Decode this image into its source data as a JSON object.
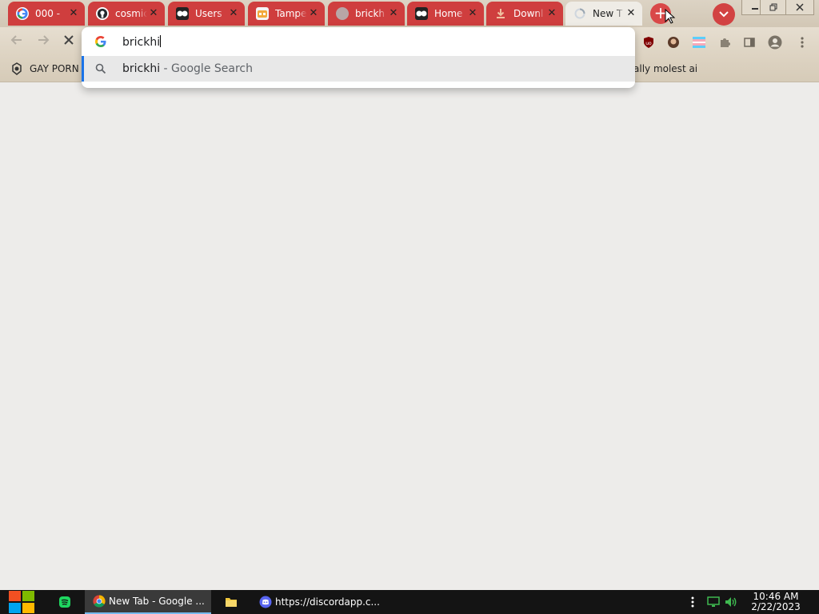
{
  "tabs": [
    {
      "title": "000 -",
      "favicon": "google-g-icon"
    },
    {
      "title": "cosmic",
      "favicon": "github-icon"
    },
    {
      "title": "Users",
      "favicon": "tumblr-like-icon"
    },
    {
      "title": "Tampe",
      "favicon": "tampermonkey-icon"
    },
    {
      "title": "brickh",
      "favicon": "globe-icon"
    },
    {
      "title": "Home",
      "favicon": "tumblr-like-icon"
    },
    {
      "title": "Downl",
      "favicon": "download-icon"
    },
    {
      "title": "New T",
      "favicon": "loading-spinner-icon",
      "active": true
    }
  ],
  "tab_close_glyph": "✕",
  "new_tab_glyph": "+",
  "omnibox": {
    "input_text": "brickhi",
    "suggestion_query": "brickhi",
    "suggestion_desc": " - Google Search"
  },
  "bookmarks": {
    "left_label": "GAY PORN",
    "right_label": "ally molest ai"
  },
  "taskbar": {
    "items": [
      {
        "label": "New Tab - Google ..."
      },
      {
        "label": "https://discordapp.c..."
      }
    ],
    "time": "10:46 AM",
    "date": "2/22/2023"
  },
  "colors": {
    "tab_red": "#cf3e3e",
    "accent_blue": "#1a73e8",
    "taskbar_bg": "#141414"
  }
}
